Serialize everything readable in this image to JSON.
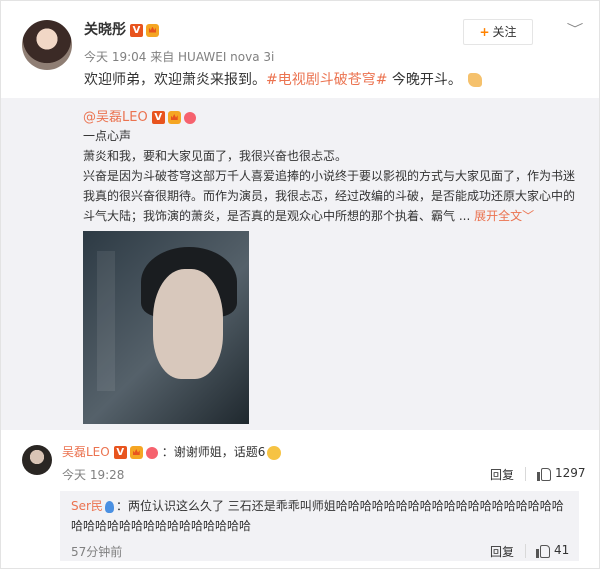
{
  "post": {
    "username": "关晓彤",
    "follow_label": "关注",
    "follow_plus": "+",
    "dropdown": "﹀",
    "time": "今天 19:04 来自 HUAWEI nova 3i",
    "text_before": "欢迎师弟，欢迎萧炎来报到。",
    "hashtag": "#电视剧斗破苍穹#",
    "text_after": " 今晚开斗。"
  },
  "repost": {
    "username": "@吴磊LEO",
    "line1": "一点心声",
    "line2": "萧炎和我，要和大家见面了，我很兴奋也很忐忑。",
    "line3": "兴奋是因为斗破苍穹这部万千人喜爱追捧的小说终于要以影视的方式与大家见面了，作为书迷",
    "line4": "我真的很兴奋很期待。而作为演员，我很忐忑，经过改编的斗破，是否能成功还原大家心中的",
    "line5": "斗气大陆；我饰演的萧炎，是否真的是观众心中所想的那个执着、霸气 ...",
    "expand_label": "展开全文",
    "expand_arrow": "﹀"
  },
  "comment": {
    "username": "吴磊LEO",
    "text": "：谢谢师姐，话题6",
    "time": "今天 19:28",
    "reply_label": "回复",
    "likes": "1297"
  },
  "sub_reply": {
    "username": "Ser民",
    "text": "：两位认识这么久了 三石还是乖乖叫师姐哈哈哈哈哈哈哈哈哈哈哈哈哈哈哈哈哈哈哈哈哈哈哈哈哈哈哈哈哈哈哈哈哈哈",
    "time": "57分钟前",
    "reply_label": "回复",
    "likes": "41"
  },
  "colors": {
    "accent": "#eb7350",
    "muted": "#808080",
    "repost_bg": "#f2f2f5"
  }
}
